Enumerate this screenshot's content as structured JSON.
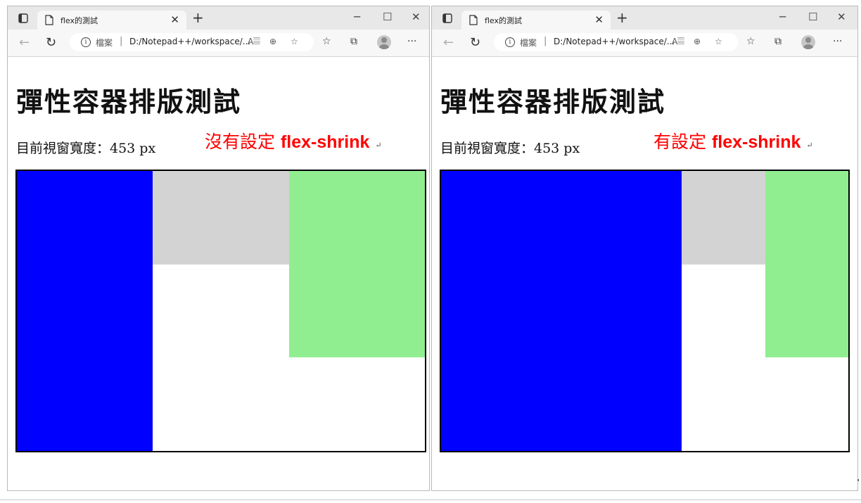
{
  "windows": [
    {
      "tab_title": "flex的測試",
      "address": {
        "label": "檔案",
        "separator": "|",
        "url": "D:/Notepad++/workspace/..."
      },
      "page": {
        "heading": "彈性容器排版測試",
        "width_text": "目前視窗寬度：453 px",
        "note_prefix": "沒有設定",
        "note_keyword": "flex-shrink"
      },
      "boxes": [
        {
          "color": "#0000ff",
          "name": "blue"
        },
        {
          "color": "#d3d3d3",
          "name": "gray"
        },
        {
          "color": "#90ee90",
          "name": "green"
        }
      ]
    },
    {
      "tab_title": "flex的測試",
      "address": {
        "label": "檔案",
        "separator": "|",
        "url": "D:/Notepad++/workspace/..."
      },
      "page": {
        "heading": "彈性容器排版測試",
        "width_text": "目前視窗寬度：453 px",
        "note_prefix": "有設定",
        "note_keyword": "flex-shrink"
      },
      "boxes": [
        {
          "color": "#0000ff",
          "name": "blue"
        },
        {
          "color": "#d3d3d3",
          "name": "gray"
        },
        {
          "color": "#90ee90",
          "name": "green"
        }
      ]
    }
  ],
  "icons": {
    "tab_actions": "tab-actions-icon",
    "page": "page-icon",
    "close": "close-icon",
    "new_tab": "plus-icon",
    "minimize": "minimize-icon",
    "maximize": "maximize-icon",
    "back": "back-arrow-icon",
    "refresh": "refresh-icon",
    "info": "info-icon",
    "read_aloud": "read-aloud-icon",
    "zoom": "zoom-icon",
    "add_favorite": "add-favorite-icon",
    "favorites": "favorites-icon",
    "collections": "collections-icon",
    "profile": "profile-avatar",
    "more": "more-icon",
    "return_mark": "return-mark-icon"
  },
  "colors": {
    "note": "#ff0000"
  }
}
